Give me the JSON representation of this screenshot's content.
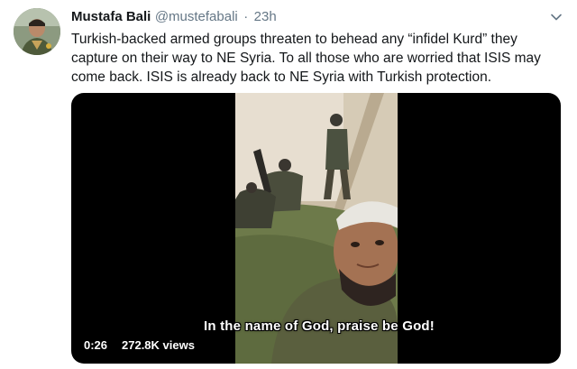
{
  "tweet": {
    "author_name": "Mustafa Bali",
    "handle": "@mustefabali",
    "separator": "·",
    "time": "23h",
    "text": "Turkish-backed armed groups threaten to behead any “infidel Kurd” they capture on their way to NE Syria. To all those who are worried that ISIS may come back. ISIS is already back to NE Syria with Turkish protection."
  },
  "video": {
    "subtitle": "In the name of God, praise be God!",
    "duration": "0:26",
    "views": "272.8K views"
  },
  "icons": {
    "menu": "chevron-down-icon",
    "avatar": "avatar-photo"
  },
  "colors": {
    "text": "#14171a",
    "secondary": "#657786",
    "media_background": "#000000",
    "badge_background": "#000000b8"
  }
}
